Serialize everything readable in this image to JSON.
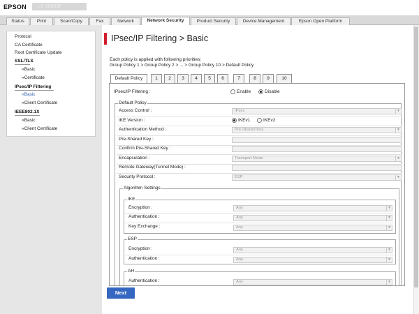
{
  "app": {
    "brand": "EPSON",
    "model": "LX-10000F"
  },
  "nav_tabs": [
    "Status",
    "Print",
    "Scan/Copy",
    "Fax",
    "Network",
    "Network Security",
    "Product Security",
    "Device Management",
    "Epson Open Platform"
  ],
  "active_nav_tab": "Network Security",
  "sidebar": {
    "protocol": "Protocol",
    "ca_certificate": "CA Certificate",
    "root_certificate_update": "Root Certificate Update",
    "ssl_tls": "SSL/TLS",
    "ssl_basic": "»Basic",
    "ssl_certificate": "»Certificate",
    "ipsec_filtering": "IPsec/IP Filtering",
    "ipsec_basic": "»Basic",
    "ipsec_client_cert": "»Client Certificate",
    "ieee8021x": "IEEE802.1X",
    "ieee_basic": "»Basic",
    "ieee_client_cert": "»Client Certificate"
  },
  "page_title": "IPsec/IP Filtering > Basic",
  "description": {
    "line1": "Each policy is applied with following priorities:",
    "line2": "Group Policy 1 > Group Policy 2 > ... > Group Policy 10 > Default Policy"
  },
  "policy_tabs": [
    "Default Policy",
    "1",
    "2",
    "3",
    "4",
    "5",
    "6",
    "7",
    "8",
    "9",
    "10"
  ],
  "filtering": {
    "label": "IPsec/IP Filtering :",
    "enable": "Enable",
    "disable": "Disable",
    "selected": "Disable"
  },
  "default_policy": {
    "legend": "Default Policy",
    "access_control": {
      "label": "Access Control :",
      "value": "IPsec"
    },
    "ike_version": {
      "label": "IKE Version :",
      "option1": "IKEv1",
      "option2": "IKEv2",
      "selected": "IKEv1"
    },
    "auth_method": {
      "label": "Authentication Method :",
      "value": "Pre-Shared Key"
    },
    "pre_shared_key": {
      "label": "Pre-Shared Key :",
      "value": ""
    },
    "confirm_key": {
      "label": "Confirm Pre-Shared Key :",
      "value": ""
    },
    "encapsulation": {
      "label": "Encapsulation :",
      "value": "Transport Mode"
    },
    "remote_gateway": {
      "label": "Remote Gateway(Tunnel Mode) :",
      "value": ""
    },
    "security_protocol": {
      "label": "Security Protocol :",
      "value": "ESP"
    }
  },
  "algorithm": {
    "legend": "Algorithm Settings",
    "ike": {
      "legend": "IKE",
      "encryption": {
        "label": "Encryption :",
        "value": "Any"
      },
      "authentication": {
        "label": "Authentication :",
        "value": "Any"
      },
      "key_exchange": {
        "label": "Key Exchange :",
        "value": "Any"
      }
    },
    "esp": {
      "legend": "ESP",
      "encryption": {
        "label": "Encryption :",
        "value": "Any"
      },
      "authentication": {
        "label": "Authentication :",
        "value": "Any"
      }
    },
    "ah": {
      "legend": "AH",
      "authentication": {
        "label": "Authentication :",
        "value": "Any"
      }
    }
  },
  "next_button": "Next",
  "colors": {
    "accent_red": "#d21f2d",
    "button_blue": "#3566c2",
    "link_blue": "#2a5aa8"
  }
}
